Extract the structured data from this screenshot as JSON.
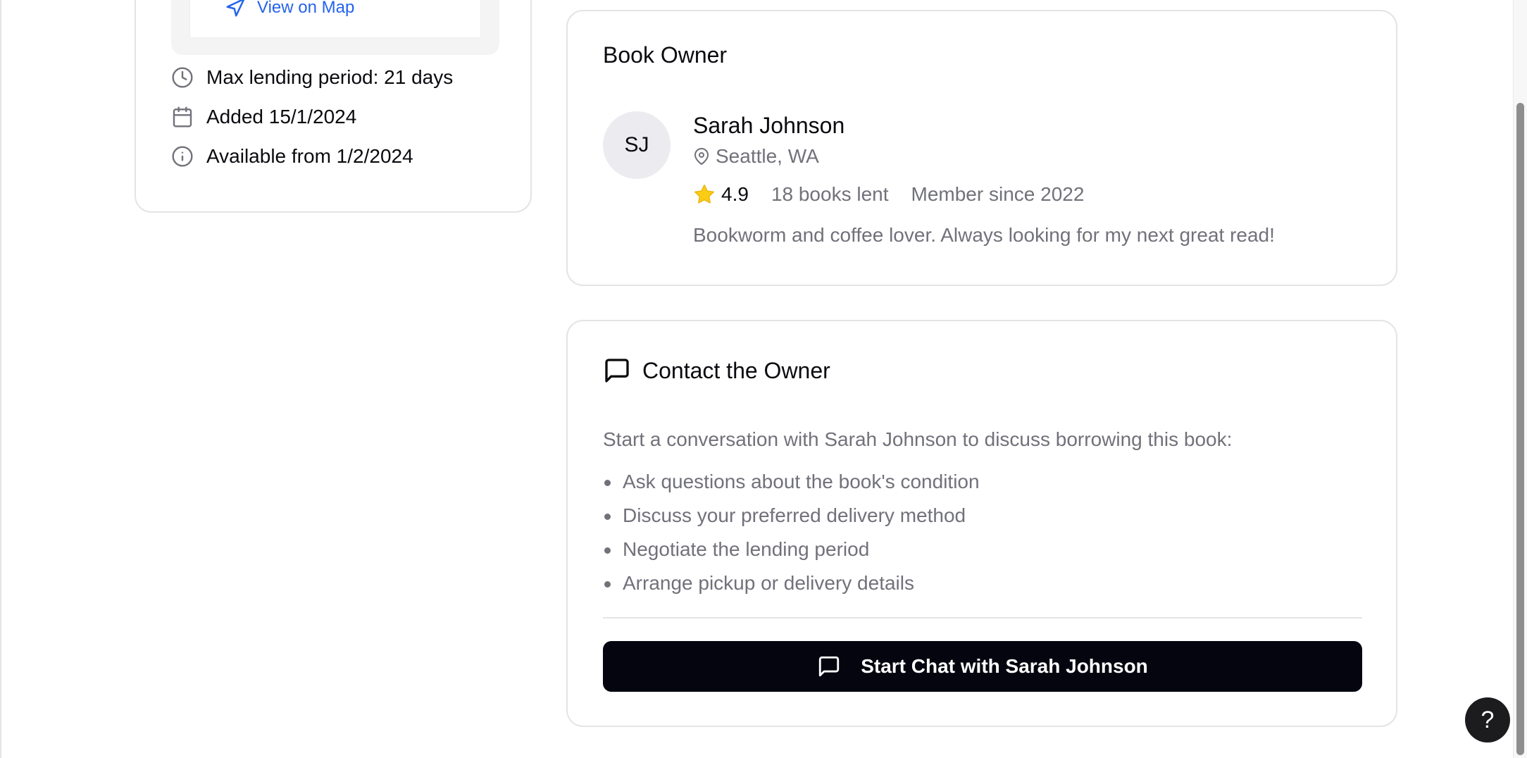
{
  "book_details": {
    "view_on_map": "View on Map",
    "max_lending": "Max lending period: 21 days",
    "added": "Added 15/1/2024",
    "available": "Available from 1/2/2024"
  },
  "owner": {
    "section_title": "Book Owner",
    "initials": "SJ",
    "name": "Sarah Johnson",
    "location": "Seattle, WA",
    "rating": "4.9",
    "books_lent": "18 books lent",
    "member_since": "Member since 2022",
    "bio": "Bookworm and coffee lover. Always looking for my next great read!"
  },
  "contact": {
    "title": "Contact the Owner",
    "intro": "Start a conversation with Sarah Johnson to discuss borrowing this book:",
    "items": [
      "Ask questions about the book's condition",
      "Discuss your preferred delivery method",
      "Negotiate the lending period",
      "Arrange pickup or delivery details"
    ],
    "button_label": "Start Chat with Sarah Johnson"
  },
  "help": {
    "label": "?"
  },
  "colors": {
    "accent_link": "#2563eb",
    "star": "#facc15",
    "button_bg": "#050510",
    "muted_text": "#71717a"
  },
  "icons": {
    "map_link": "navigation-icon",
    "max_lending": "clock-icon",
    "added": "calendar-icon",
    "available": "info-icon",
    "location": "map-pin-icon",
    "rating": "star-icon",
    "contact": "message-square-icon",
    "chat_button": "message-square-icon"
  }
}
